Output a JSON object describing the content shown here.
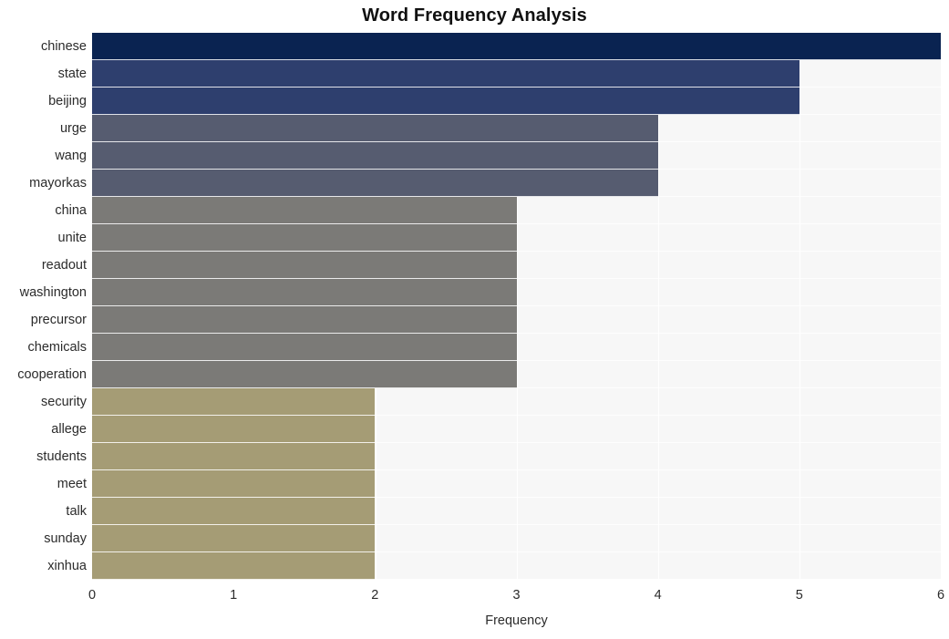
{
  "chart_data": {
    "type": "bar",
    "orientation": "horizontal",
    "title": "Word Frequency Analysis",
    "xlabel": "Frequency",
    "ylabel": "",
    "xlim": [
      0,
      6
    ],
    "xticks": [
      "0",
      "1",
      "2",
      "3",
      "4",
      "5",
      "6"
    ],
    "grid": true,
    "legend": false,
    "categories": [
      "chinese",
      "state",
      "beijing",
      "urge",
      "wang",
      "mayorkas",
      "china",
      "unite",
      "readout",
      "washington",
      "precursor",
      "chemicals",
      "cooperation",
      "security",
      "allege",
      "students",
      "meet",
      "talk",
      "sunday",
      "xinhua"
    ],
    "values": [
      6,
      5,
      5,
      4,
      4,
      4,
      3,
      3,
      3,
      3,
      3,
      3,
      3,
      2,
      2,
      2,
      2,
      2,
      2,
      2
    ],
    "bar_colors": [
      "#0a2351",
      "#2e3f6e",
      "#2e3f6e",
      "#565c70",
      "#565c70",
      "#565c70",
      "#7b7a77",
      "#7b7a77",
      "#7b7a77",
      "#7b7a77",
      "#7b7a77",
      "#7b7a77",
      "#7b7a77",
      "#a59c75",
      "#a59c75",
      "#a59c75",
      "#a59c75",
      "#a59c75",
      "#a59c75",
      "#a59c75"
    ],
    "plot_background": "#f7f7f7",
    "gridline_color": "#ffffff",
    "figure_background": "#ffffff",
    "text_color": "#2b2b2b",
    "title_color": "#111111"
  }
}
